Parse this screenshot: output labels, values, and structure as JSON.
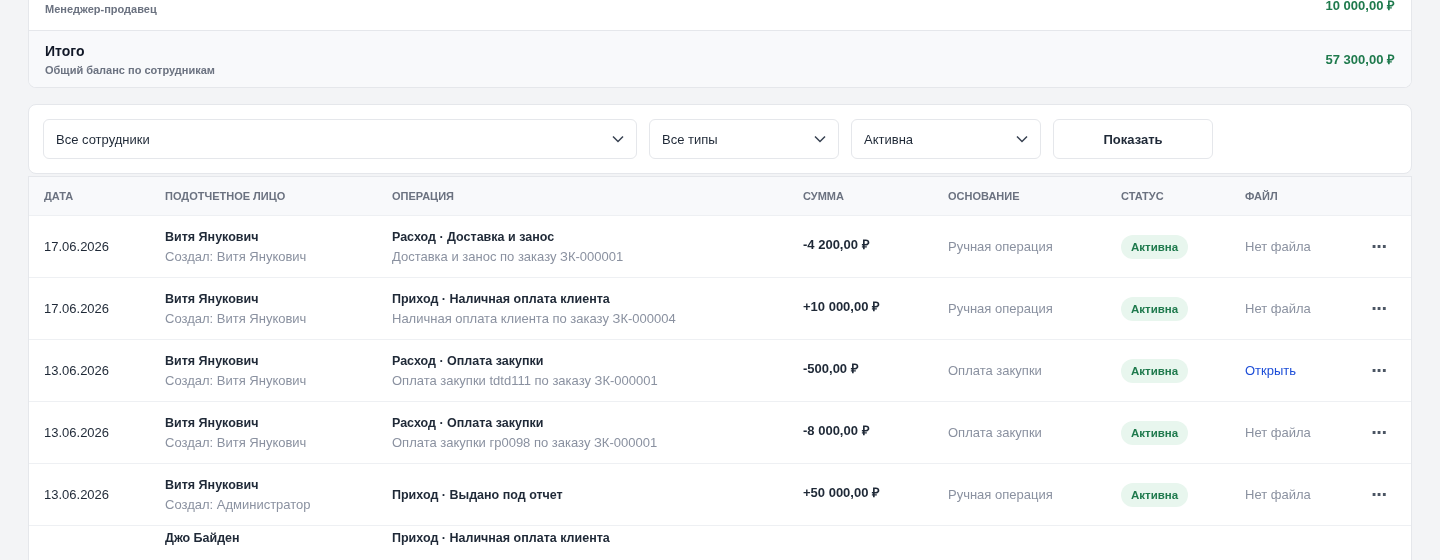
{
  "summary": {
    "rows": [
      {
        "kind": "employee",
        "subtitle": "Менеджер-продавец",
        "amount": "10 000,00 ₽"
      },
      {
        "kind": "total",
        "title": "Итого",
        "subtitle": "Общий баланс по сотрудникам",
        "amount": "57 300,00 ₽"
      }
    ]
  },
  "filters": {
    "selects": [
      {
        "value": "Все сотрудники"
      },
      {
        "value": "Все типы"
      },
      {
        "value": "Активна"
      }
    ],
    "button": "Показать"
  },
  "table": {
    "columns": [
      "ДАТА",
      "ПОДОТЧЕТНОЕ ЛИЦО",
      "ОПЕРАЦИЯ",
      "СУММА",
      "ОСНОВАНИЕ",
      "СТАТУС",
      "ФАЙЛ"
    ],
    "rows": [
      {
        "date": "17.06.2026",
        "person": "Витя Янукович",
        "creator": "Создал: Витя Янукович",
        "operation": "Расход · Доставка и занос",
        "details": "Доставка и занос по заказу ЗК-000001",
        "amount": "-4 200,00 ₽",
        "basis": "Ручная операция",
        "status": {
          "kind": "active",
          "label": "Активна"
        },
        "file": {
          "kind": "none",
          "label": "Нет файла"
        },
        "menu": "···"
      },
      {
        "date": "17.06.2026",
        "person": "Витя Янукович",
        "creator": "Создал: Витя Янукович",
        "operation": "Приход · Наличная оплата клиента",
        "details": "Наличная оплата клиента по заказу ЗК-000004",
        "amount": "+10 000,00 ₽",
        "basis": "Ручная операция",
        "status": {
          "kind": "active",
          "label": "Активна"
        },
        "file": {
          "kind": "none",
          "label": "Нет файла"
        },
        "menu": "···"
      },
      {
        "date": "13.06.2026",
        "person": "Витя Янукович",
        "creator": "Создал: Витя Янукович",
        "operation": "Расход · Оплата закупки",
        "details": "Оплата закупки tdtd111 по заказу ЗК-000001",
        "amount": "-500,00 ₽",
        "basis": "Оплата закупки",
        "status": {
          "kind": "active",
          "label": "Активна"
        },
        "file": {
          "kind": "link",
          "label": "Открыть"
        },
        "menu": "···"
      },
      {
        "date": "13.06.2026",
        "person": "Витя Янукович",
        "creator": "Создал: Витя Янукович",
        "operation": "Расход · Оплата закупки",
        "details": "Оплата закупки гр0098 по заказу ЗК-000001",
        "amount": "-8 000,00 ₽",
        "basis": "Оплата закупки",
        "status": {
          "kind": "active",
          "label": "Активна"
        },
        "file": {
          "kind": "none",
          "label": "Нет файла"
        },
        "menu": "···"
      },
      {
        "date": "13.06.2026",
        "person": "Витя Янукович",
        "creator": "Создал: Администратор",
        "operation": "Приход · Выдано под отчет",
        "amount": "+50 000,00 ₽",
        "basis": "Ручная операция",
        "status": {
          "kind": "active",
          "label": "Активна"
        },
        "file": {
          "kind": "none",
          "label": "Нет файла"
        },
        "menu": "···"
      },
      {
        "person": "Джо Байден",
        "operation": "Приход · Наличная оплата клиента"
      }
    ]
  }
}
